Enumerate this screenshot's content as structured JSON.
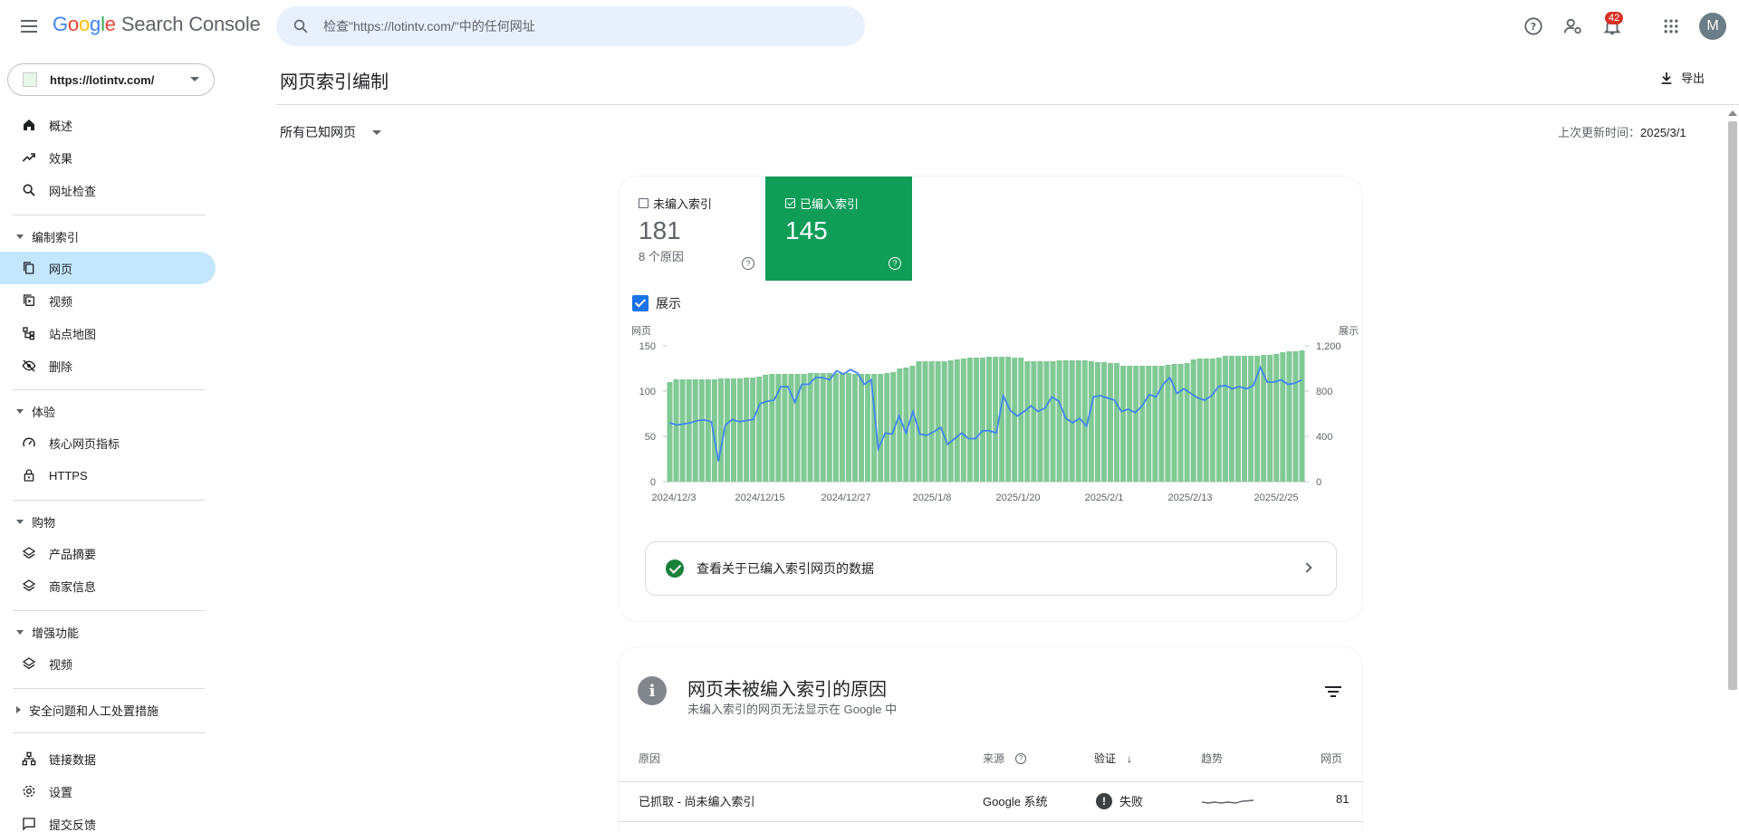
{
  "header": {
    "logo": {
      "g": "G",
      "o1": "o",
      "o2": "o",
      "g2": "g",
      "l": "l",
      "e": "e",
      "product": "Search Console"
    },
    "search_placeholder": "检查\"https://lotintv.com/\"中的任何网址",
    "notification_count": "42",
    "avatar_letter": "M"
  },
  "sidebar": {
    "property": "https://lotintv.com/",
    "items": [
      {
        "label": "概述",
        "icon": "home-icon"
      },
      {
        "label": "效果",
        "icon": "trending-up-icon"
      },
      {
        "label": "网址检查",
        "icon": "search-icon"
      }
    ],
    "sections": [
      {
        "title": "编制索引",
        "items": [
          {
            "label": "网页",
            "icon": "pages-icon"
          },
          {
            "label": "视频",
            "icon": "video-icon"
          },
          {
            "label": "站点地图",
            "icon": "sitemap-icon"
          },
          {
            "label": "删除",
            "icon": "removal-icon"
          }
        ]
      },
      {
        "title": "体验",
        "items": [
          {
            "label": "核心网页指标",
            "icon": "speed-icon"
          },
          {
            "label": "HTTPS",
            "icon": "lock-icon"
          }
        ]
      },
      {
        "title": "购物",
        "items": [
          {
            "label": "产品摘要",
            "icon": "layers-icon"
          },
          {
            "label": "商家信息",
            "icon": "layers-icon"
          }
        ]
      },
      {
        "title": "增强功能",
        "items": [
          {
            "label": "视频",
            "icon": "layers-icon"
          }
        ]
      },
      {
        "title": "安全问题和人工处置措施",
        "items": []
      }
    ],
    "bottom_items": [
      {
        "label": "链接数据",
        "icon": "links-icon"
      },
      {
        "label": "设置",
        "icon": "gear-icon"
      },
      {
        "label": "提交反馈",
        "icon": "feedback-icon"
      }
    ]
  },
  "main": {
    "title": "网页索引编制",
    "export_label": "导出",
    "filter_label": "所有已知网页",
    "updated_label": "上次更新时间：",
    "updated_value": "2025/3/1",
    "not_indexed": {
      "label": "未编入索引",
      "count": "181",
      "sub": "8 个原因"
    },
    "indexed": {
      "label": "已编入索引",
      "count": "145"
    },
    "impressions_label": "展示",
    "view_data_label": "查看关于已编入索引网页的数据"
  },
  "reasons": {
    "title": "网页未被编入索引的原因",
    "subtitle": "未编入索引的网页无法显示在 Google 中",
    "columns": {
      "reason": "原因",
      "source": "来源",
      "validation": "验证",
      "trend": "趋势",
      "pages": "网页"
    },
    "rows": [
      {
        "reason": "已抓取 - 尚未编入索引",
        "source": "Google 系统",
        "validation": "失败",
        "pages": "81"
      }
    ]
  },
  "chart_data": {
    "type": "bar",
    "ylabel": "网页",
    "y2label": "展示",
    "ylim": [
      0,
      150
    ],
    "y2lim": [
      0,
      1200
    ],
    "yticks": [
      "0",
      "50",
      "100",
      "150"
    ],
    "y2ticks": [
      "0",
      "400",
      "800",
      "1,200"
    ],
    "xticks": [
      "2024/12/3",
      "2024/12/15",
      "2024/12/27",
      "2025/1/8",
      "2025/1/20",
      "2025/2/1",
      "2025/2/13",
      "2025/2/25"
    ],
    "series": [
      {
        "name": "已编入索引",
        "type": "bar",
        "color": "#81c995",
        "values": [
          110,
          113,
          113,
          113,
          113,
          113,
          113,
          113,
          114,
          114,
          114,
          114,
          115,
          115,
          116,
          118,
          119,
          119,
          119,
          119,
          119,
          119,
          120,
          120,
          120,
          120,
          120,
          120,
          120,
          119,
          119,
          119,
          119,
          119,
          120,
          121,
          125,
          126,
          128,
          133,
          133,
          133,
          133,
          133,
          134,
          135,
          136,
          137,
          137,
          137,
          138,
          138,
          138,
          138,
          137,
          137,
          133,
          133,
          133,
          133,
          133,
          134,
          134,
          134,
          134,
          134,
          133,
          132,
          132,
          131,
          131,
          128,
          128,
          128,
          128,
          128,
          128,
          128,
          129,
          130,
          130,
          131,
          135,
          136,
          136,
          136,
          137,
          139,
          139,
          139,
          139,
          139,
          139,
          140,
          140,
          141,
          143,
          144,
          144,
          145
        ]
      },
      {
        "name": "展示",
        "type": "line",
        "color": "#4285f4",
        "values": [
          520,
          500,
          510,
          520,
          540,
          545,
          530,
          180,
          500,
          550,
          530,
          540,
          550,
          690,
          710,
          720,
          840,
          840,
          700,
          860,
          860,
          920,
          920,
          900,
          980,
          950,
          990,
          960,
          860,
          900,
          290,
          430,
          420,
          580,
          430,
          620,
          420,
          410,
          440,
          480,
          330,
          380,
          430,
          380,
          380,
          450,
          450,
          430,
          760,
          630,
          580,
          620,
          670,
          620,
          650,
          750,
          710,
          560,
          520,
          560,
          490,
          750,
          760,
          740,
          720,
          620,
          640,
          610,
          670,
          770,
          750,
          860,
          920,
          780,
          820,
          780,
          740,
          720,
          760,
          840,
          850,
          820,
          840,
          820,
          850,
          1010,
          880,
          880,
          900,
          860,
          870,
          900
        ]
      }
    ]
  }
}
